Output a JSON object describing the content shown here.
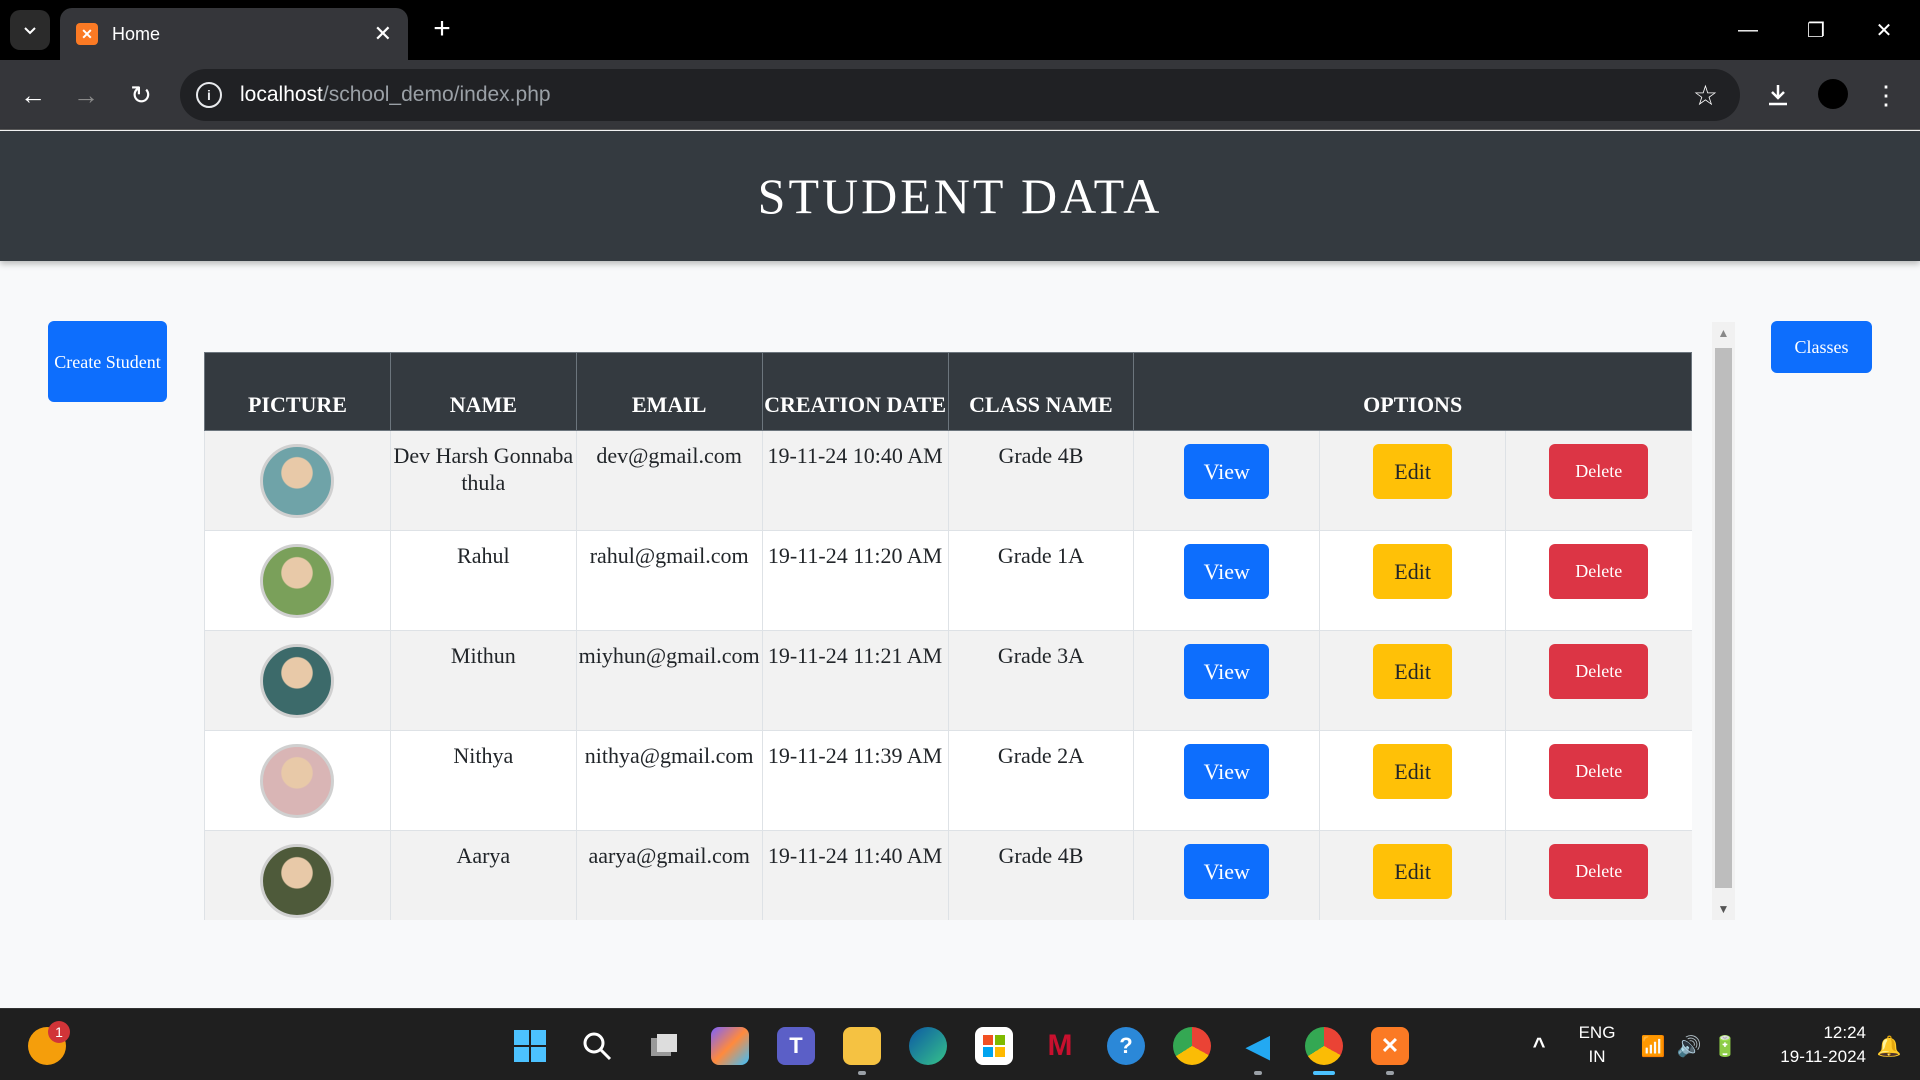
{
  "browser": {
    "tab_title": "Home",
    "url_host": "localhost",
    "url_path": "/school_demo/index.php"
  },
  "page": {
    "title": "STUDENT DATA",
    "create_button": "Create Student",
    "classes_button": "Classes"
  },
  "table": {
    "headers": [
      "PICTURE",
      "NAME",
      "EMAIL",
      "CREATION DATE",
      "CLASS NAME",
      "OPTIONS"
    ],
    "rows": [
      {
        "name": "Dev Harsh Gonnabathula",
        "email": "dev@gmail.com",
        "date": "19-11-24 10:40 AM",
        "class": "Grade 4B",
        "avatar_color": "#6fa3a8"
      },
      {
        "name": "Rahul",
        "email": "rahul@gmail.com",
        "date": "19-11-24 11:20 AM",
        "class": "Grade 1A",
        "avatar_color": "#7aa05a"
      },
      {
        "name": "Mithun",
        "email": "miyhun@gmail.com",
        "date": "19-11-24 11:21 AM",
        "class": "Grade 3A",
        "avatar_color": "#3c6a6a"
      },
      {
        "name": "Nithya",
        "email": "nithya@gmail.com",
        "date": "19-11-24 11:39 AM",
        "class": "Grade 2A",
        "avatar_color": "#d9b5b5"
      },
      {
        "name": "Aarya",
        "email": "aarya@gmail.com",
        "date": "19-11-24 11:40 AM",
        "class": "Grade 4B",
        "avatar_color": "#4e5a3a"
      }
    ],
    "actions": {
      "view": "View",
      "edit": "Edit",
      "delete": "Delete"
    }
  },
  "taskbar": {
    "notification_count": "1",
    "lang_top": "ENG",
    "lang_bottom": "IN",
    "time": "12:24",
    "date": "19-11-2024"
  },
  "colors": {
    "primary": "#0d6efd",
    "warning": "#ffc107",
    "danger": "#dc3545",
    "header_dark": "#343a40"
  }
}
